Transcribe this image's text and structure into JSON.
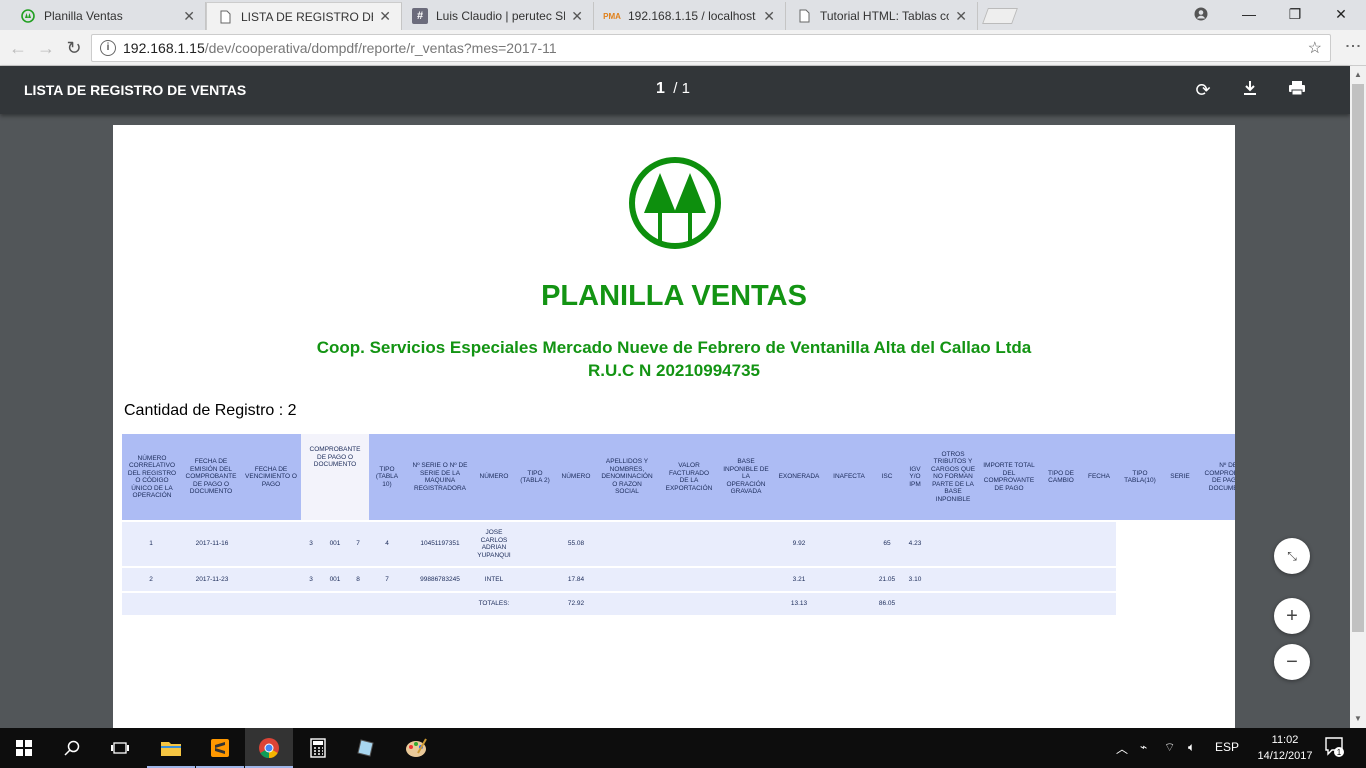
{
  "tabs": [
    {
      "title": "Planilla Ventas",
      "icon": "coop-logo-icon"
    },
    {
      "title": "LISTA DE REGISTRO DE V",
      "icon": "document-icon"
    },
    {
      "title": "Luis Claudio | perutec Sla",
      "icon": "slack-hash-icon"
    },
    {
      "title": "192.168.1.15 / localhost /",
      "icon": "phpmyadmin-icon"
    },
    {
      "title": "Tutorial HTML: Tablas co",
      "icon": "document-icon"
    }
  ],
  "address": {
    "host": "192.168.1.15",
    "path": "/dev/cooperativa/dompdf/reporte/r_ventas?mes=2017-11"
  },
  "pdf": {
    "title": "LISTA DE REGISTRO DE VENTAS",
    "page": "1",
    "total": "/ 1"
  },
  "doc": {
    "title": "PLANILLA VENTAS",
    "org": "Coop. Servicios Especiales Mercado Nueve de Febrero de Ventanilla Alta del Callao Ltda",
    "ruc": "R.U.C N 20210994735",
    "count": "Cantidad de Registro : 2"
  },
  "table": {
    "headers": [
      "NÚMERO CORRELATIVO DEL REGISTRO O CÓDIGO ÚNICO DE LA OPERACIÓN",
      "FECHA DE EMISIÓN DEL COMPROBANTE DE PAGO O DOCUMENTO",
      "FECHA DE VENCIMIENTO O PAGO",
      "COMPROBANTE DE PAGO O DOCUMENTO",
      "TIPO (TABLA 10)",
      "Nº SERIE O Nº DE SERIE DE LA MAQUINA REGISTRADORA",
      "NÚMERO",
      "TIPO (TABLA 2)",
      "NÚMERO",
      "APELLIDOS Y NOMBRES, DENOMINACIÓN O RAZON SOCIAL",
      "VALOR FACTURADO DE LA EXPORTACIÓN",
      "BASE INPONIBLE DE LA OPERACIÓN GRAVADA",
      "EXONERADA",
      "INAFECTA",
      "ISC",
      "IGV Y/O IPM",
      "OTROS TRIBUTOS Y CARGOS QUE NO FORMAN PARTE DE LA BASE INPONIBLE",
      "IMPORTE TOTAL DEL COMPROVANTE DE PAGO",
      "TIPO DE CAMBIO",
      "FECHA",
      "TIPO TABLA(10)",
      "SERIE",
      "Nº DEL COMPROBANTE DE PAGO O DOCUMENTO"
    ],
    "rows": [
      {
        "n": "1",
        "fecha": "2017-11-16",
        "a": "3",
        "b": "001",
        "c": "7",
        "tipo": "4",
        "doc": "10451197351",
        "nombre": "JOSE CARLOS ADRIAN YUPANQUI",
        "numero": "55.08",
        "exonerada": "9.92",
        "isc": "65",
        "igv": "4.23"
      },
      {
        "n": "2",
        "fecha": "2017-11-23",
        "a": "3",
        "b": "001",
        "c": "8",
        "tipo": "7",
        "doc": "99886783245",
        "nombre": "INTEL",
        "numero": "17.84",
        "exonerada": "3.21",
        "isc": "21.05",
        "igv": "3.10"
      }
    ],
    "totals": {
      "label": "TOTALES:",
      "numero": "72.92",
      "exonerada": "13.13",
      "isc": "86.05"
    }
  },
  "taskbar": {
    "lang": "ESP",
    "time": "11:02",
    "date": "14/12/2017",
    "notif": "1"
  }
}
